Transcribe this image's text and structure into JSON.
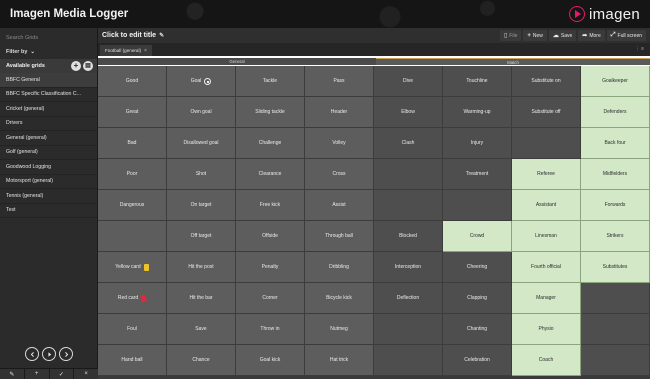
{
  "app": {
    "title": "Imagen Media Logger",
    "brand": "imagen",
    "accent": "#e5196a"
  },
  "sidebar": {
    "search_placeholder": "Search Grids",
    "filter_label": "Filter by",
    "grids_header": "Available grids",
    "items": [
      {
        "label": "BBFC General",
        "active": true
      },
      {
        "label": "BBFC Specific Classification C..."
      },
      {
        "label": "Cricket (general)"
      },
      {
        "label": "Drivers"
      },
      {
        "label": "General (general)"
      },
      {
        "label": "Golf (general)"
      },
      {
        "label": "Goodwood Logging"
      },
      {
        "label": "Motorsport (general)"
      },
      {
        "label": "Tennis (general)"
      },
      {
        "label": "Test"
      }
    ],
    "tools": [
      "✎",
      "+",
      "✓",
      "×"
    ]
  },
  "header": {
    "title": "Click to edit title",
    "actions": {
      "file": "File",
      "new": "New",
      "save": "Save",
      "more": "More",
      "fullscreen": "Full screen"
    }
  },
  "tabs": [
    {
      "label": "Football (general)"
    }
  ],
  "sections": {
    "general": "General",
    "match": "Match"
  },
  "grid": {
    "columns": 8,
    "cells": [
      {
        "t": "Good"
      },
      {
        "t": "Goal",
        "icon": "ball"
      },
      {
        "t": "Tackle"
      },
      {
        "t": "Pass"
      },
      {
        "t": "Dive",
        "d": 1
      },
      {
        "t": "Touchline",
        "d": 1
      },
      {
        "t": "Substitute on",
        "d": 1
      },
      {
        "t": "Goalkeeper",
        "g": 1
      },
      {
        "t": "Great"
      },
      {
        "t": "Own goal"
      },
      {
        "t": "Sliding tackle"
      },
      {
        "t": "Header"
      },
      {
        "t": "Elbow",
        "d": 1
      },
      {
        "t": "Warming-up",
        "d": 1
      },
      {
        "t": "Substitute off",
        "d": 1
      },
      {
        "t": "Defenders",
        "g": 1
      },
      {
        "t": "Bad"
      },
      {
        "t": "Disallowed goal"
      },
      {
        "t": "Challenge"
      },
      {
        "t": "Volley"
      },
      {
        "t": "Clash",
        "d": 1
      },
      {
        "t": "Injury",
        "d": 1
      },
      {
        "t": "",
        "d": 1
      },
      {
        "t": "Back four",
        "g": 1
      },
      {
        "t": "Poor"
      },
      {
        "t": "Shot"
      },
      {
        "t": "Clearance"
      },
      {
        "t": "Cross"
      },
      {
        "t": "",
        "d": 1
      },
      {
        "t": "Treatment",
        "d": 1
      },
      {
        "t": "Referee",
        "g": 1
      },
      {
        "t": "Midfielders",
        "g": 1
      },
      {
        "t": "Dangerous"
      },
      {
        "t": "On target"
      },
      {
        "t": "Free kick"
      },
      {
        "t": "Assist"
      },
      {
        "t": "",
        "d": 1
      },
      {
        "t": "",
        "d": 1
      },
      {
        "t": "Assistant",
        "g": 1
      },
      {
        "t": "Forwards",
        "g": 1
      },
      {
        "t": ""
      },
      {
        "t": "Off target"
      },
      {
        "t": "Offside"
      },
      {
        "t": "Through ball"
      },
      {
        "t": "Blocked",
        "d": 1
      },
      {
        "t": "Crowd",
        "g": 1
      },
      {
        "t": "Linesman",
        "g": 1
      },
      {
        "t": "Strikers",
        "g": 1
      },
      {
        "t": "Yellow card",
        "icon": "yellow"
      },
      {
        "t": "Hit the post"
      },
      {
        "t": "Penalty"
      },
      {
        "t": "Dribbling"
      },
      {
        "t": "Interception",
        "d": 1
      },
      {
        "t": "Cheering",
        "d": 1
      },
      {
        "t": "Fourth official",
        "g": 1
      },
      {
        "t": "Substitutes",
        "g": 1
      },
      {
        "t": "Red card",
        "icon": "red"
      },
      {
        "t": "Hit the bar"
      },
      {
        "t": "Corner"
      },
      {
        "t": "Bicycle kick"
      },
      {
        "t": "Deflection",
        "d": 1
      },
      {
        "t": "Clapping",
        "d": 1
      },
      {
        "t": "Manager",
        "g": 1
      },
      {
        "t": "",
        "d": 1
      },
      {
        "t": "Foul"
      },
      {
        "t": "Save"
      },
      {
        "t": "Throw in"
      },
      {
        "t": "Nutmeg"
      },
      {
        "t": "",
        "d": 1
      },
      {
        "t": "Chanting",
        "d": 1
      },
      {
        "t": "Physio",
        "g": 1
      },
      {
        "t": "",
        "d": 1
      },
      {
        "t": "Hand ball"
      },
      {
        "t": "Chance"
      },
      {
        "t": "Goal kick"
      },
      {
        "t": "Hat trick"
      },
      {
        "t": "",
        "d": 1
      },
      {
        "t": "Celebration",
        "d": 1
      },
      {
        "t": "Coach",
        "g": 1
      },
      {
        "t": "",
        "d": 1
      }
    ]
  }
}
